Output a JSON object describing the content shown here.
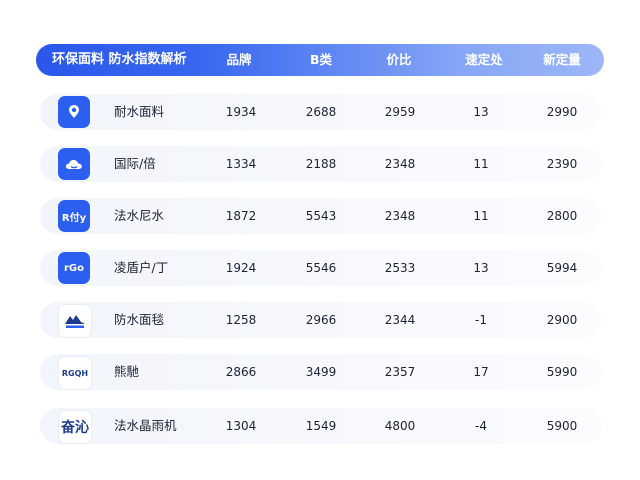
{
  "header": {
    "title": "环保面料  防水指数解析",
    "columns": [
      "品牌",
      "B类",
      "价比",
      "速定处",
      "新定量"
    ]
  },
  "rows": [
    {
      "icon": "location-pin-icon",
      "icon_text": "",
      "name": "耐水面料",
      "values": [
        "1934",
        "2688",
        "2959",
        "13",
        "2990"
      ]
    },
    {
      "icon": "cloud-icon",
      "icon_text": "",
      "name": "国际/倍",
      "values": [
        "1334",
        "2188",
        "2348",
        "11",
        "2390"
      ]
    },
    {
      "icon": "text-logo-icon",
      "icon_text": "R付y",
      "name": "法水尼水",
      "values": [
        "1872",
        "5543",
        "2348",
        "11",
        "2800"
      ]
    },
    {
      "icon": "text-logo-icon",
      "icon_text": "rGo",
      "name": "凌盾户/丁",
      "values": [
        "1924",
        "5546",
        "2533",
        "13",
        "5994"
      ]
    },
    {
      "icon": "mountain-logo-icon",
      "icon_text": "",
      "name": "防水面毯",
      "values": [
        "1258",
        "2966",
        "2344",
        "-1",
        "2900"
      ]
    },
    {
      "icon": "text-logo-icon",
      "icon_text": "RGQH",
      "name": "熊馳",
      "values": [
        "2866",
        "3499",
        "2357",
        "17",
        "5990"
      ]
    },
    {
      "icon": "text-logo-icon",
      "icon_text": "奋沁",
      "name": "法水晶雨机",
      "values": [
        "1304",
        "1549",
        "4800",
        "-4",
        "5900"
      ]
    }
  ]
}
